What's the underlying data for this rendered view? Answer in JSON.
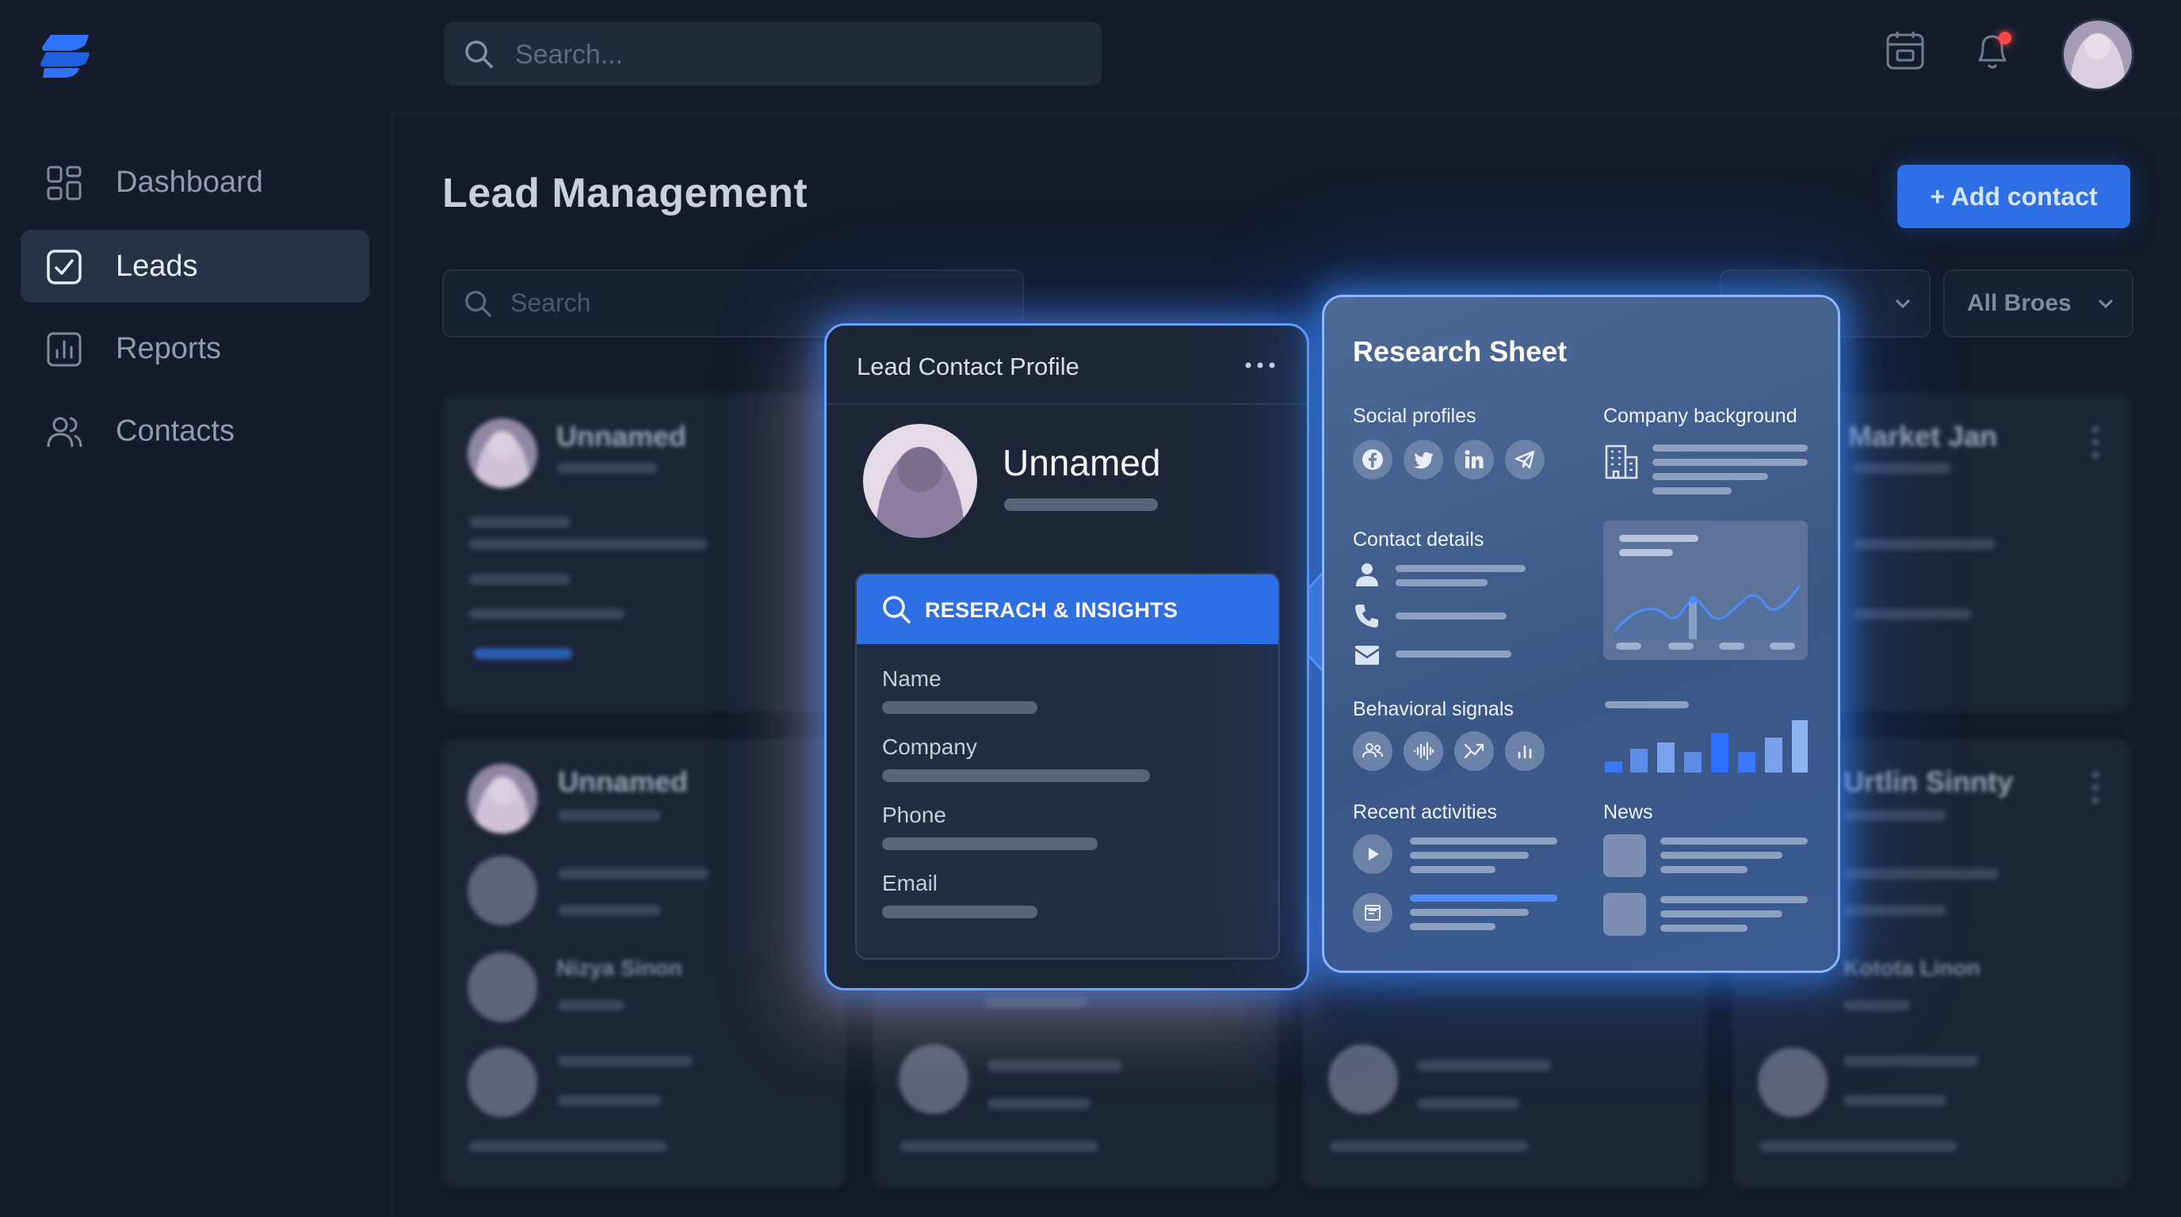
{
  "app": {
    "brand_color": "#2e6fe6"
  },
  "sidebar": {
    "items": [
      {
        "label": "Dashboard",
        "icon": "grid-icon",
        "active": false
      },
      {
        "label": "Leads",
        "icon": "checkbox-icon",
        "active": true
      },
      {
        "label": "Reports",
        "icon": "bar-chart-icon",
        "active": false
      },
      {
        "label": "Contacts",
        "icon": "users-icon",
        "active": false
      }
    ]
  },
  "topbar": {
    "search_placeholder": "Search..."
  },
  "main": {
    "title": "Lead Management",
    "add_contact_label": "+ Add contact",
    "filter_search_placeholder": "Search",
    "filter_dropdown_label": "All Broes"
  },
  "cards": [
    {
      "name": "Unnamed"
    },
    {
      "name": "Unnamed",
      "sub": "Nizya Sinon"
    },
    {
      "name": "Market Jan"
    },
    {
      "name": "Urtlin Sinnty",
      "sub": "Kotota Linon"
    }
  ],
  "profile": {
    "title": "Lead Contact Profile",
    "name": "Unnamed",
    "section_label": "RESERACH & INSIGHTS",
    "fields": [
      "Name",
      "Company",
      "Phone",
      "Email"
    ]
  },
  "research": {
    "title": "Research Sheet",
    "social_profiles": "Social profiles",
    "company_background": "Company background",
    "contact_details": "Contact details",
    "behavioral_signals": "Behavioral signals",
    "recent_activities": "Recent activities",
    "news": "News"
  }
}
